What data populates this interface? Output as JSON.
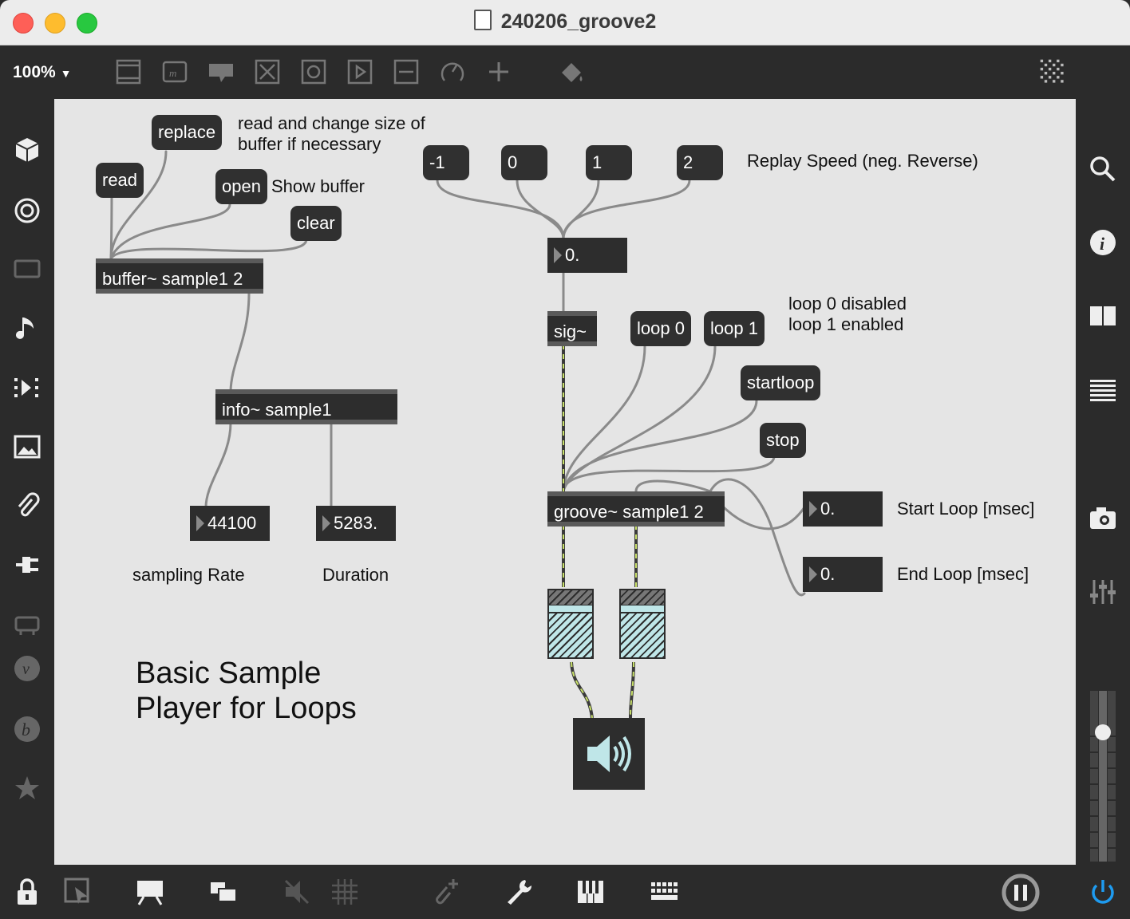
{
  "window": {
    "title": "240206_groove2"
  },
  "toolbar": {
    "zoom": "100%",
    "icons": [
      "new-object-icon",
      "message-box-icon",
      "comment-icon",
      "toggle-icon",
      "button-icon",
      "play-icon",
      "slider-icon",
      "dial-icon",
      "add-icon",
      "paint-bucket-icon",
      "grid-menu-icon"
    ]
  },
  "left_sidebar": {
    "icons": [
      "package-cube-icon",
      "target-icon",
      "monitor-icon",
      "music-note-icon",
      "media-player-icon",
      "image-icon",
      "paperclip-icon",
      "plug-icon",
      "hardware-icon",
      "vimeo-icon",
      "bandcamp-icon",
      "star-icon"
    ]
  },
  "right_sidebar": {
    "icons": [
      "search-icon",
      "info-icon",
      "split-view-icon",
      "list-icon",
      "snapshot-camera-icon",
      "mixer-sliders-icon",
      "volume-meter-icon"
    ]
  },
  "bottom_bar": {
    "icons": [
      "lock-icon",
      "edit-cursor-icon",
      "presentation-icon",
      "windows-icon",
      "mute-icon",
      "grid-icon",
      "paperclip-add-icon",
      "wrench-icon",
      "piano-keys-icon",
      "keyboard-icon",
      "pause-dsp-icon",
      "power-icon"
    ]
  },
  "patch": {
    "messages": {
      "replace": "replace",
      "read": "read",
      "open": "open",
      "clear": "clear",
      "minus_one": "-1",
      "zero": "0",
      "one": "1",
      "two": "2",
      "loop0": "loop 0",
      "loop1": "loop 1",
      "startloop": "startloop",
      "stop": "stop"
    },
    "objects": {
      "buffer": "buffer~ sample1 2",
      "info": "info~ sample1",
      "sig": "sig~",
      "groove": "groove~ sample1 2"
    },
    "numbers": {
      "speed": "0.",
      "sampling_rate": "44100",
      "duration": "5283.",
      "start_loop": "0.",
      "end_loop": "0."
    },
    "comments": {
      "read_change": "read and change size of\nbuffer if necessary",
      "show_buffer": "Show buffer",
      "replay_speed": "Replay Speed (neg. Reverse)",
      "loop_states": "loop 0 disabled\nloop 1 enabled",
      "start_loop": "Start Loop [msec]",
      "end_loop": "End Loop [msec]",
      "sampling_rate": "sampling Rate",
      "duration": "Duration",
      "title": "Basic Sample\nPlayer for Loops"
    },
    "colors": {
      "canvas": "#e5e5e5",
      "object": "#2d2d2d",
      "signal_wire": "#c8e06a",
      "control_wire": "#8a8a8a",
      "gain_fill": "#bfe6e8",
      "accent_blue": "#1e9bf0"
    }
  }
}
